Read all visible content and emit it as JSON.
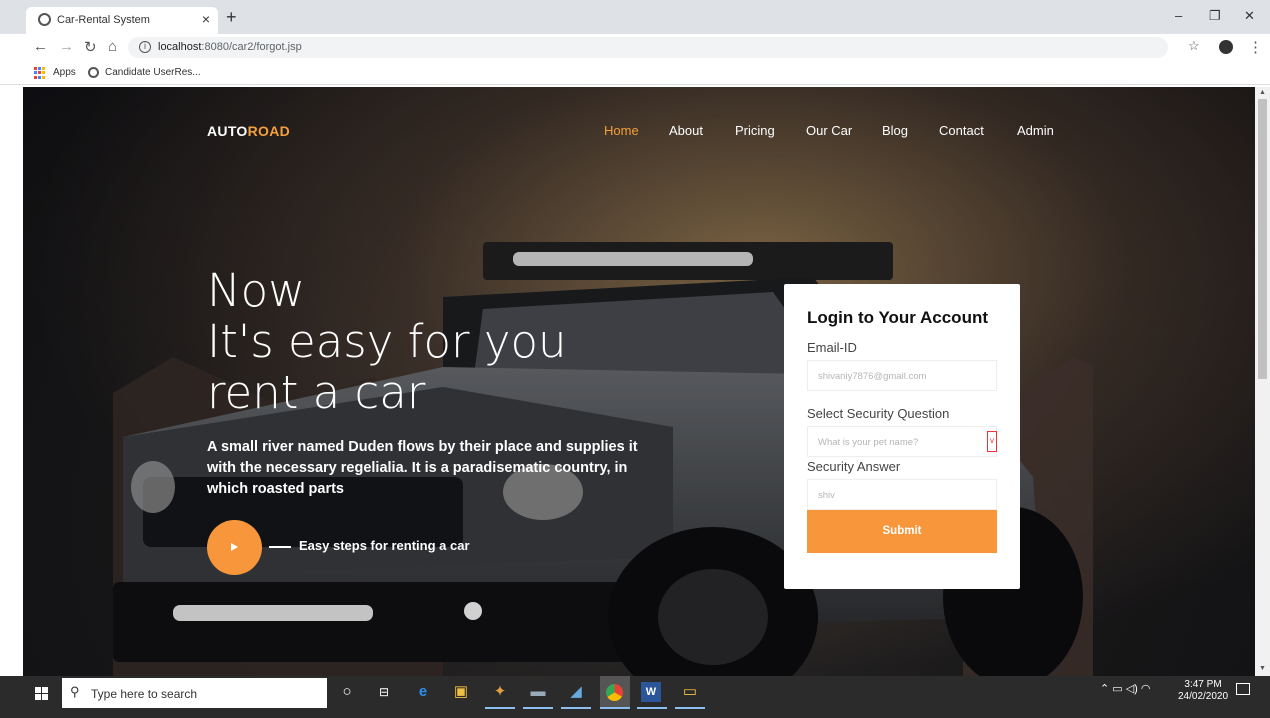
{
  "browser": {
    "tab_title": "Car-Rental System",
    "tab_close": "×",
    "new_tab": "+",
    "window_min": "–",
    "window_max": "❐",
    "window_close": "✕",
    "url_host": "localhost",
    "url_path": ":8080/car2/forgot.jsp",
    "bookmarks": [
      "Apps",
      "Candidate UserRes..."
    ]
  },
  "site": {
    "logo_part1": "AUTO",
    "logo_part2": "ROAD",
    "nav": [
      "Home",
      "About",
      "Pricing",
      "Our Car",
      "Blog",
      "Contact",
      "Admin"
    ],
    "active_nav": "Home",
    "accent_color": "#f7963a"
  },
  "hero": {
    "line1": "Now",
    "line2": "It's easy for you",
    "line3": "rent a car",
    "description": "A small river named Duden flows by their place and supplies it with the necessary regelialia. It is a paradisematic country, in which roasted parts",
    "steps_label": "Easy steps for renting a car"
  },
  "login_card": {
    "title": "Login to Your Account",
    "email_label": "Email-ID",
    "email_value": "shivaniy7876@gmail.com",
    "question_label": "Select Security Question",
    "question_value": "What is your pet name?",
    "answer_label": "Security Answer",
    "answer_value": "shiv",
    "submit_label": "Submit"
  },
  "taskbar": {
    "search_placeholder": "Type here to search",
    "time": "3:47 PM",
    "date": "24/02/2020"
  }
}
